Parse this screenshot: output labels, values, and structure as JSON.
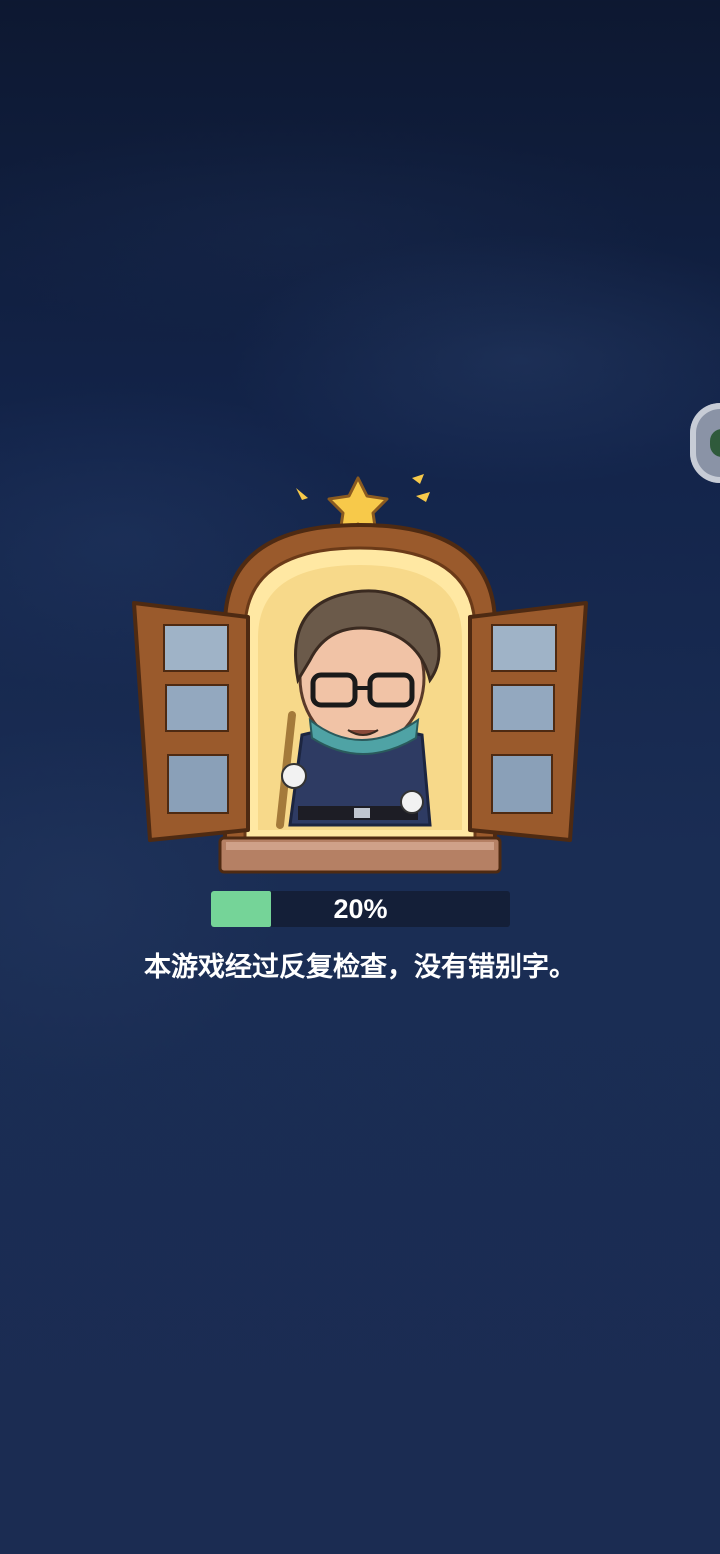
{
  "loading": {
    "progress_fraction": 0.2,
    "progress_text": "20%",
    "tip": "本游戏经过反复检查，没有错别字。"
  },
  "colors": {
    "progress_fill": "#75d498",
    "progress_track": "#141f38",
    "background_top": "#0d1831",
    "background_bottom": "#1b2c52"
  },
  "illustration": {
    "subject": "character-in-window",
    "icons": [
      "star-icon",
      "window-icon"
    ]
  }
}
